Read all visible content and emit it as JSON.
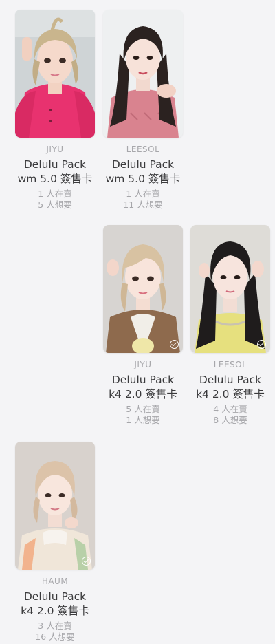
{
  "cards": [
    {
      "member": "JIYU",
      "line1": "Delulu Pack",
      "line2": "wm 5.0 簽售卡",
      "selling": "1 人在賣",
      "wanting": "5 人想要"
    },
    {
      "member": "LEESOL",
      "line1": "Delulu Pack",
      "line2": "wm 5.0 簽售卡",
      "selling": "1 人在賣",
      "wanting": "11 人想要"
    },
    {
      "member": "JIYU",
      "line1": "Delulu Pack",
      "line2": "k4 2.0 簽售卡",
      "selling": "5 人在賣",
      "wanting": "1 人想要"
    },
    {
      "member": "LEESOL",
      "line1": "Delulu Pack",
      "line2": "k4 2.0 簽售卡",
      "selling": "4 人在賣",
      "wanting": "8 人想要"
    },
    {
      "member": "HAUM",
      "line1": "Delulu Pack",
      "line2": "k4 2.0 簽售卡",
      "selling": "3 人在賣",
      "wanting": "16 人想要"
    }
  ],
  "icons": {
    "owned_check": "check-circle-icon"
  },
  "colors": {
    "background": "#f4f4f6",
    "member_text": "#a7a7ab",
    "title_text": "#3a3a3c",
    "stat_text": "#a6a6aa"
  }
}
